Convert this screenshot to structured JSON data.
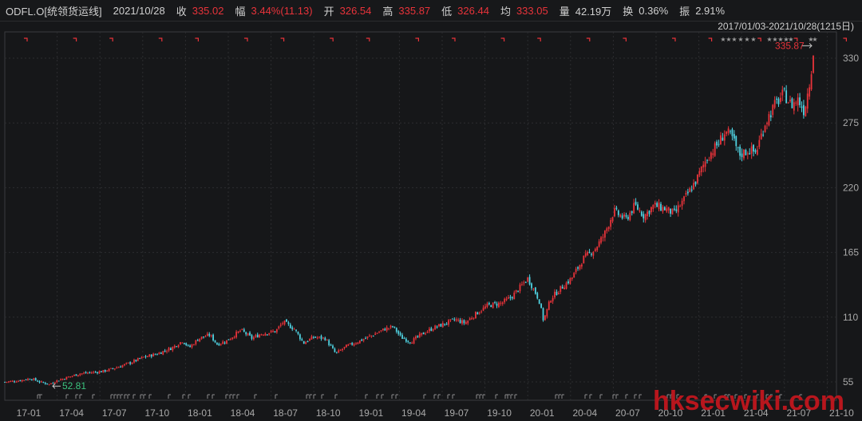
{
  "header": {
    "symbol": "ODFL.O[统领货运线]",
    "date": "2021/10/28",
    "close_label": "收",
    "close_value": "335.02",
    "change_label": "幅",
    "change_value": "3.44%(11.13)",
    "open_label": "开",
    "open_value": "326.54",
    "high_label": "高",
    "high_value": "335.87",
    "low_label": "低",
    "low_value": "326.44",
    "avg_label": "均",
    "avg_value": "333.05",
    "volume_label": "量",
    "volume_value": "42.19万",
    "turnover_label": "换",
    "turnover_value": "0.36%",
    "amplitude_label": "振",
    "amplitude_value": "2.91%"
  },
  "range_label": "2017/01/03-2021/10/28(1215日)",
  "watermark": "hksecwiki.com",
  "colors": {
    "up": "#e8333a",
    "down": "#4fd1e0",
    "grid": "#2c2d30",
    "background": "#161719"
  },
  "chart_data": {
    "type": "candlestick",
    "title": "",
    "xlabel": "",
    "ylabel": "",
    "ylim": [
      50,
      340
    ],
    "y_ticks": [
      55,
      110,
      165,
      220,
      275,
      330
    ],
    "x_ticks": [
      "17-01",
      "17-04",
      "17-07",
      "17-10",
      "18-01",
      "18-04",
      "18-07",
      "18-10",
      "19-01",
      "19-04",
      "19-07",
      "19-10",
      "20-01",
      "20-04",
      "20-07",
      "20-10",
      "21-01",
      "21-04",
      "21-07",
      "21-10"
    ],
    "max_price": {
      "label": "335.87",
      "value": 335.87,
      "date": "2021-10-28"
    },
    "min_price": {
      "label": "52.81",
      "value": 52.81,
      "date": "2017-04"
    },
    "price_path": [
      [
        "2017-01-03",
        55
      ],
      [
        "2017-02-01",
        56
      ],
      [
        "2017-03-01",
        58
      ],
      [
        "2017-03-20",
        55
      ],
      [
        "2017-04-10",
        53
      ],
      [
        "2017-04-25",
        56
      ],
      [
        "2017-05-20",
        59
      ],
      [
        "2017-06-15",
        62
      ],
      [
        "2017-07-10",
        63
      ],
      [
        "2017-08-05",
        64
      ],
      [
        "2017-09-01",
        67
      ],
      [
        "2017-10-01",
        71
      ],
      [
        "2017-11-01",
        76
      ],
      [
        "2017-12-01",
        79
      ],
      [
        "2018-01-02",
        84
      ],
      [
        "2018-01-25",
        90
      ],
      [
        "2018-02-08",
        84
      ],
      [
        "2018-03-01",
        92
      ],
      [
        "2018-03-25",
        95
      ],
      [
        "2018-04-10",
        87
      ],
      [
        "2018-05-01",
        90
      ],
      [
        "2018-06-01",
        99
      ],
      [
        "2018-06-25",
        92
      ],
      [
        "2018-07-15",
        96
      ],
      [
        "2018-08-15",
        98
      ],
      [
        "2018-09-01",
        106
      ],
      [
        "2018-09-25",
        100
      ],
      [
        "2018-10-15",
        88
      ],
      [
        "2018-11-05",
        93
      ],
      [
        "2018-12-01",
        92
      ],
      [
        "2018-12-24",
        79
      ],
      [
        "2019-01-15",
        85
      ],
      [
        "2019-02-15",
        90
      ],
      [
        "2019-03-15",
        95
      ],
      [
        "2019-04-10",
        100
      ],
      [
        "2019-04-28",
        102
      ],
      [
        "2019-05-15",
        93
      ],
      [
        "2019-06-05",
        89
      ],
      [
        "2019-07-01",
        96
      ],
      [
        "2019-07-25",
        101
      ],
      [
        "2019-08-15",
        104
      ],
      [
        "2019-09-10",
        108
      ],
      [
        "2019-10-01",
        105
      ],
      [
        "2019-10-25",
        113
      ],
      [
        "2019-11-20",
        120
      ],
      [
        "2019-12-20",
        122
      ],
      [
        "2020-01-10",
        127
      ],
      [
        "2020-02-15",
        143
      ],
      [
        "2020-03-10",
        125
      ],
      [
        "2020-03-20",
        107
      ],
      [
        "2020-04-05",
        126
      ],
      [
        "2020-04-25",
        134
      ],
      [
        "2020-05-20",
        143
      ],
      [
        "2020-06-15",
        160
      ],
      [
        "2020-07-10",
        168
      ],
      [
        "2020-07-30",
        180
      ],
      [
        "2020-08-20",
        200
      ],
      [
        "2020-09-15",
        193
      ],
      [
        "2020-10-05",
        205
      ],
      [
        "2020-10-25",
        196
      ],
      [
        "2020-11-15",
        205
      ],
      [
        "2020-12-10",
        202
      ],
      [
        "2020-12-30",
        198
      ],
      [
        "2021-01-20",
        210
      ],
      [
        "2021-02-15",
        226
      ],
      [
        "2021-03-10",
        245
      ],
      [
        "2021-04-05",
        258
      ],
      [
        "2021-04-20",
        268
      ],
      [
        "2021-05-05",
        262
      ],
      [
        "2021-05-20",
        248
      ],
      [
        "2021-06-10",
        252
      ],
      [
        "2021-06-25",
        250
      ],
      [
        "2021-07-15",
        275
      ],
      [
        "2021-08-05",
        290
      ],
      [
        "2021-08-25",
        300
      ],
      [
        "2021-09-10",
        290
      ],
      [
        "2021-09-25",
        295
      ],
      [
        "2021-10-08",
        285
      ],
      [
        "2021-10-20",
        310
      ],
      [
        "2021-10-28",
        335
      ]
    ]
  }
}
